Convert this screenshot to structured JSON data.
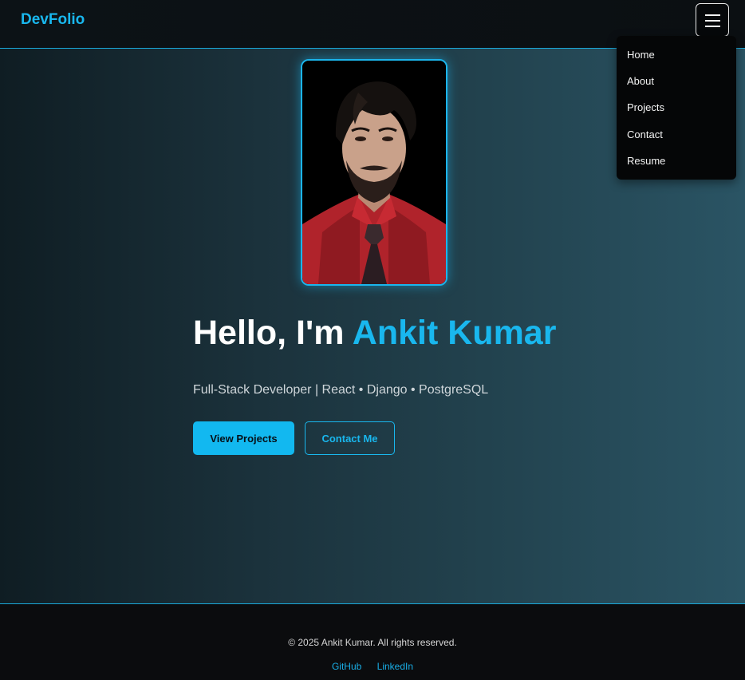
{
  "navbar": {
    "brand": "DevFolio",
    "menu_icon": "hamburger-menu-icon"
  },
  "menu": {
    "items": [
      "Home",
      "About",
      "Projects",
      "Contact",
      "Resume"
    ]
  },
  "hero": {
    "greeting": "Hello, I'm",
    "name": "Ankit Kumar",
    "subtitle": "Full-Stack Developer | React • Django • PostgreSQL",
    "primary_button": "View Projects",
    "secondary_button": "Contact Me"
  },
  "footer": {
    "copyright": "© 2025 Ankit Kumar. All rights reserved.",
    "links": [
      "GitHub",
      "LinkedIn"
    ]
  },
  "colors": {
    "accent": "#19b7ee",
    "background": "#0b0c0e",
    "hero_gradient_start": "#0f1d23",
    "hero_gradient_end": "#2a5464"
  }
}
